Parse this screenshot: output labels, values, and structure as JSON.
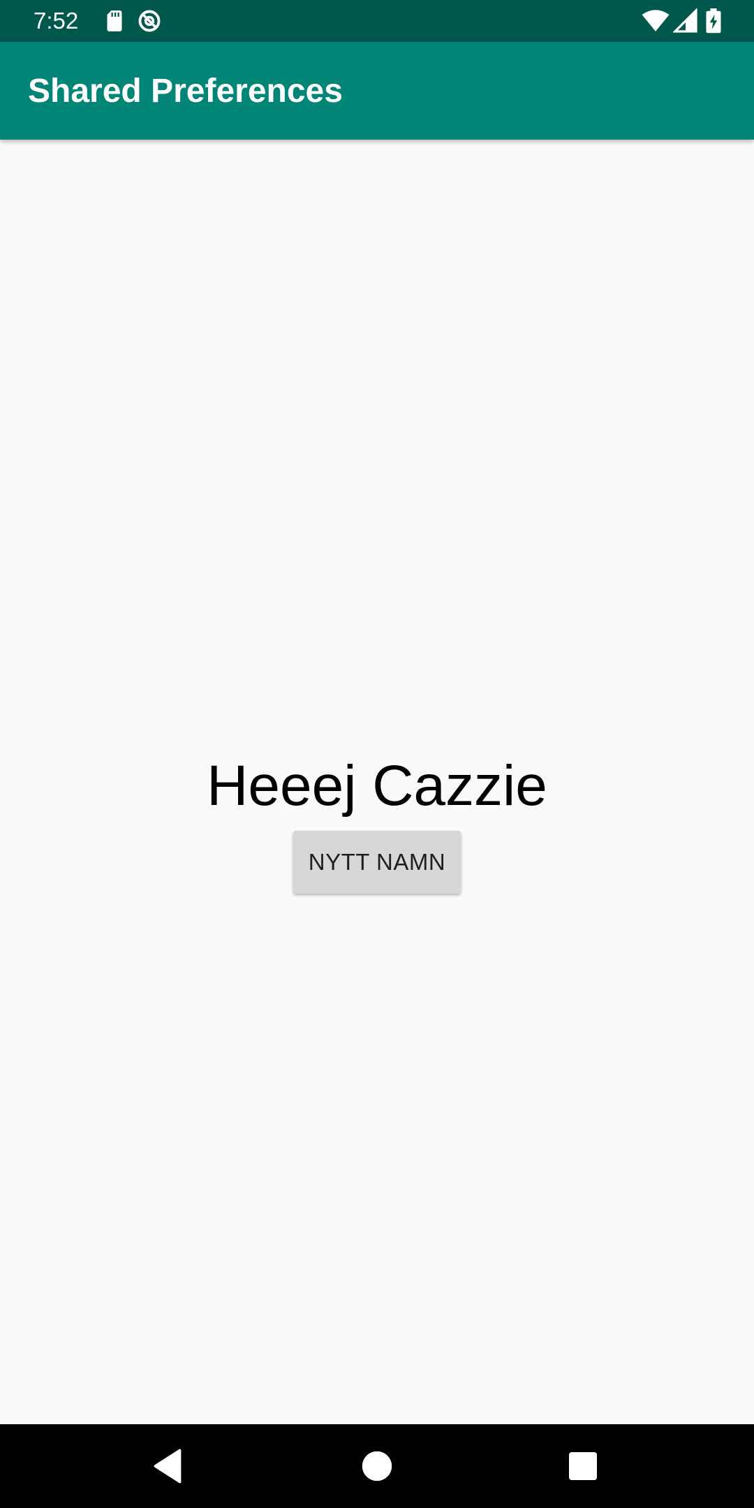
{
  "status_bar": {
    "time": "7:52",
    "left_icons": [
      "sd-card-icon",
      "no-disturb-icon"
    ],
    "right_icons": [
      "wifi-icon",
      "cellular-signal-icon",
      "battery-charging-icon"
    ],
    "background": "#00574b"
  },
  "app_bar": {
    "title": "Shared Preferences",
    "background": "#008577"
  },
  "main": {
    "greeting": "Heeej Cazzie",
    "button_label": "NYTT NAMN"
  },
  "nav_bar": {
    "buttons": [
      "back-icon",
      "home-icon",
      "recents-icon"
    ]
  }
}
